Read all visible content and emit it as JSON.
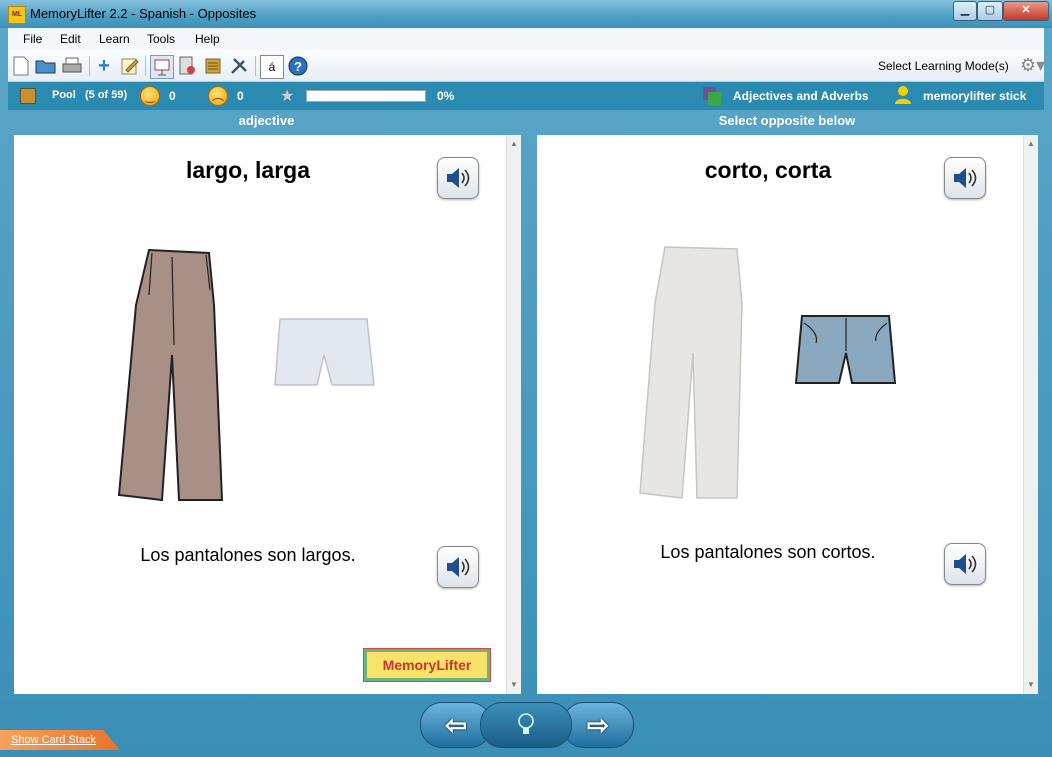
{
  "window": {
    "title": "MemoryLifter 2.2 - Spanish - Opposites",
    "app_icon": "ML",
    "controls": {
      "minimize": "▁",
      "maximize": "▢",
      "close": "✕"
    }
  },
  "menu": [
    "File",
    "Edit",
    "Learn",
    "Tools",
    "Help"
  ],
  "toolbar": {
    "icons": [
      "new-document-icon",
      "open-folder-icon",
      "print-icon",
      "add-card-icon",
      "edit-card-icon",
      "slideshow-icon",
      "statistics-icon",
      "card-stack-icon",
      "settings-tools-icon",
      "special-characters-icon",
      "help-icon"
    ],
    "special_char": "á",
    "mode_label": "Select Learning Mode(s)"
  },
  "status": {
    "pool_label": "Pool",
    "pool_count": "(5 of 59)",
    "correct_count": "0",
    "wrong_count": "0",
    "progress_percent": "0%",
    "progress_value": 0,
    "chapter": "Adjectives and Adverbs",
    "user": "memorylifter stick"
  },
  "left_card": {
    "header": "adjective",
    "word": "largo, larga",
    "sentence": "Los pantalones son largos.",
    "logo": "MemoryLifter"
  },
  "right_card": {
    "header": "Select opposite below",
    "word": "corto, corta",
    "sentence": "Los pantalones son cortos."
  },
  "bottom": {
    "show_card_stack": "Show Card Stack"
  },
  "colors": {
    "pants_long": "#a89086",
    "shorts_blue": "#8aa8c0",
    "faded": "#e8e6e4",
    "accent": "#2b8ab0"
  }
}
